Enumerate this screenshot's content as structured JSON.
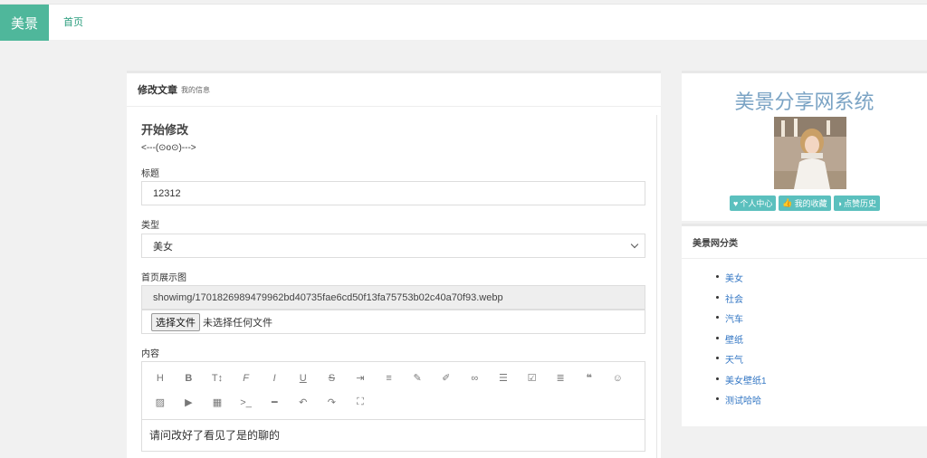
{
  "header": {
    "logo": "美景",
    "nav_home": "首页"
  },
  "main": {
    "panel_title": "修改文章",
    "panel_subtitle": "我的信息",
    "form_title": "开始修改",
    "decoration": "<---(⊙o⊙)--->",
    "title_label": "标题",
    "title_value": "12312",
    "type_label": "类型",
    "type_value": "美女",
    "image_label": "首页展示图",
    "image_path": "showimg/1701826989479962bd40735fae6cd50f13fa75753b02c40a70f93.webp",
    "file_button": "选择文件",
    "file_status": "未选择任何文件",
    "content_label": "内容",
    "content_text": "请问改好了看见了是的聊的",
    "toolbar_icons": [
      "heading-icon",
      "bold-icon",
      "text-size-icon",
      "font-icon",
      "italic-icon",
      "underline-icon",
      "strikethrough-icon",
      "indent-icon",
      "align-icon",
      "pen-icon",
      "brush-icon",
      "link-icon",
      "list-icon",
      "checkbox-icon",
      "align-right-icon",
      "quote-icon",
      "emoji-icon",
      "image-icon",
      "video-icon",
      "table-icon",
      "code-icon",
      "hr-icon",
      "undo-icon",
      "redo-icon",
      "fullscreen-icon"
    ]
  },
  "sidebar": {
    "site_title": "美景分享网系统",
    "buttons": [
      "个人中心",
      "我的收藏",
      "点赞历史"
    ],
    "category_title": "美景网分类",
    "categories": [
      "美女",
      "社会",
      "汽车",
      "壁纸",
      "天气",
      "美女壁纸1",
      "测试哈哈"
    ]
  },
  "colors": {
    "brand": "#4fb79b",
    "accent": "#5bc0be",
    "link": "#3477c4"
  }
}
